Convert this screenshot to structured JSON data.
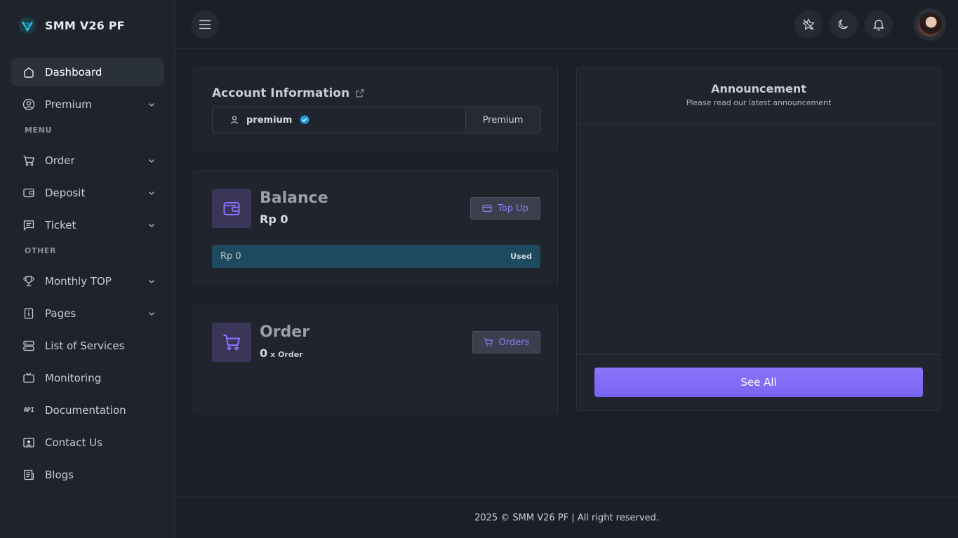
{
  "brand": {
    "name": "SMM V26 PF"
  },
  "sidebar": {
    "items_top": [
      {
        "label": "Dashboard",
        "icon": "home-icon",
        "active": true
      },
      {
        "label": "Premium",
        "icon": "user-circle-icon",
        "has_submenu": true
      }
    ],
    "section_menu": "MENU",
    "items_menu": [
      {
        "label": "Order",
        "icon": "cart-icon",
        "has_submenu": true
      },
      {
        "label": "Deposit",
        "icon": "wallet-icon",
        "has_submenu": true
      },
      {
        "label": "Ticket",
        "icon": "message-icon",
        "has_submenu": true
      }
    ],
    "section_other": "OTHER",
    "items_other": [
      {
        "label": "Monthly TOP",
        "icon": "trophy-icon",
        "has_submenu": true
      },
      {
        "label": "Pages",
        "icon": "info-page-icon",
        "has_submenu": true
      },
      {
        "label": "List of Services",
        "icon": "server-icon"
      },
      {
        "label": "Monitoring",
        "icon": "tv-icon"
      },
      {
        "label": "Documentation",
        "icon": "api-icon",
        "glyph": "API"
      },
      {
        "label": "Contact Us",
        "icon": "contact-card-icon"
      },
      {
        "label": "Blogs",
        "icon": "article-icon"
      }
    ]
  },
  "topbar": {
    "buttons": [
      "menu-toggle",
      "star-off-icon",
      "moon-icon",
      "bell-icon",
      "avatar"
    ]
  },
  "account": {
    "title": "Account Information",
    "username": "premium",
    "plan": "Premium"
  },
  "balance": {
    "title": "Balance",
    "value": "Rp 0",
    "button": "Top Up",
    "used_amount": "Rp 0",
    "used_label": "Used"
  },
  "order": {
    "title": "Order",
    "count": "0",
    "unit": "x Order",
    "button": "Orders"
  },
  "announcement": {
    "title": "Announcement",
    "subtitle": "Please read our latest announcement",
    "button": "See All"
  },
  "footer": {
    "text": "2025 © SMM V26 PF | All right reserved."
  },
  "colors": {
    "accent": "#8b74fb",
    "used_bar": "#1d4a5e",
    "background": "#1b1f26",
    "sidebar": "#1f242c"
  }
}
